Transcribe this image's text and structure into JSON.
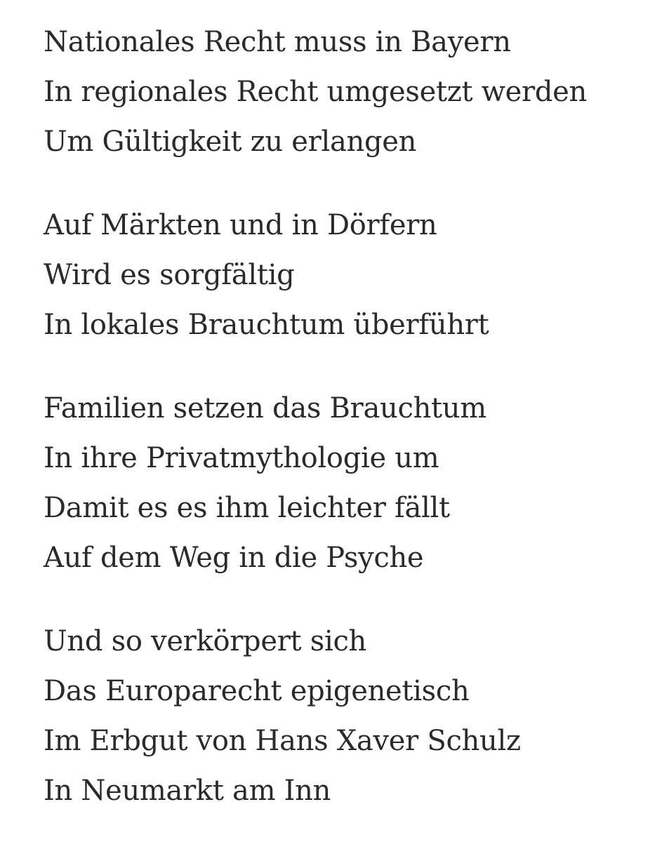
{
  "poem": {
    "stanzas": [
      {
        "lines": [
          "Nationales Recht muss in Bayern",
          "In regionales Recht umgesetzt werden",
          "Um Gültigkeit zu erlangen"
        ]
      },
      {
        "lines": [
          "Auf Märkten und in Dörfern",
          "Wird es sorgfältig",
          "In lokales Brauchtum überführt"
        ]
      },
      {
        "lines": [
          "Familien setzen das Brauchtum",
          "In ihre Privatmythologie um",
          "Damit es es ihm leichter fällt",
          "Auf dem Weg in die Psyche"
        ]
      },
      {
        "lines": [
          "Und so verkörpert sich",
          "Das Europarecht epigenetisch",
          "Im Erbgut von Hans Xaver Schulz",
          "In Neumarkt am Inn"
        ]
      }
    ]
  }
}
